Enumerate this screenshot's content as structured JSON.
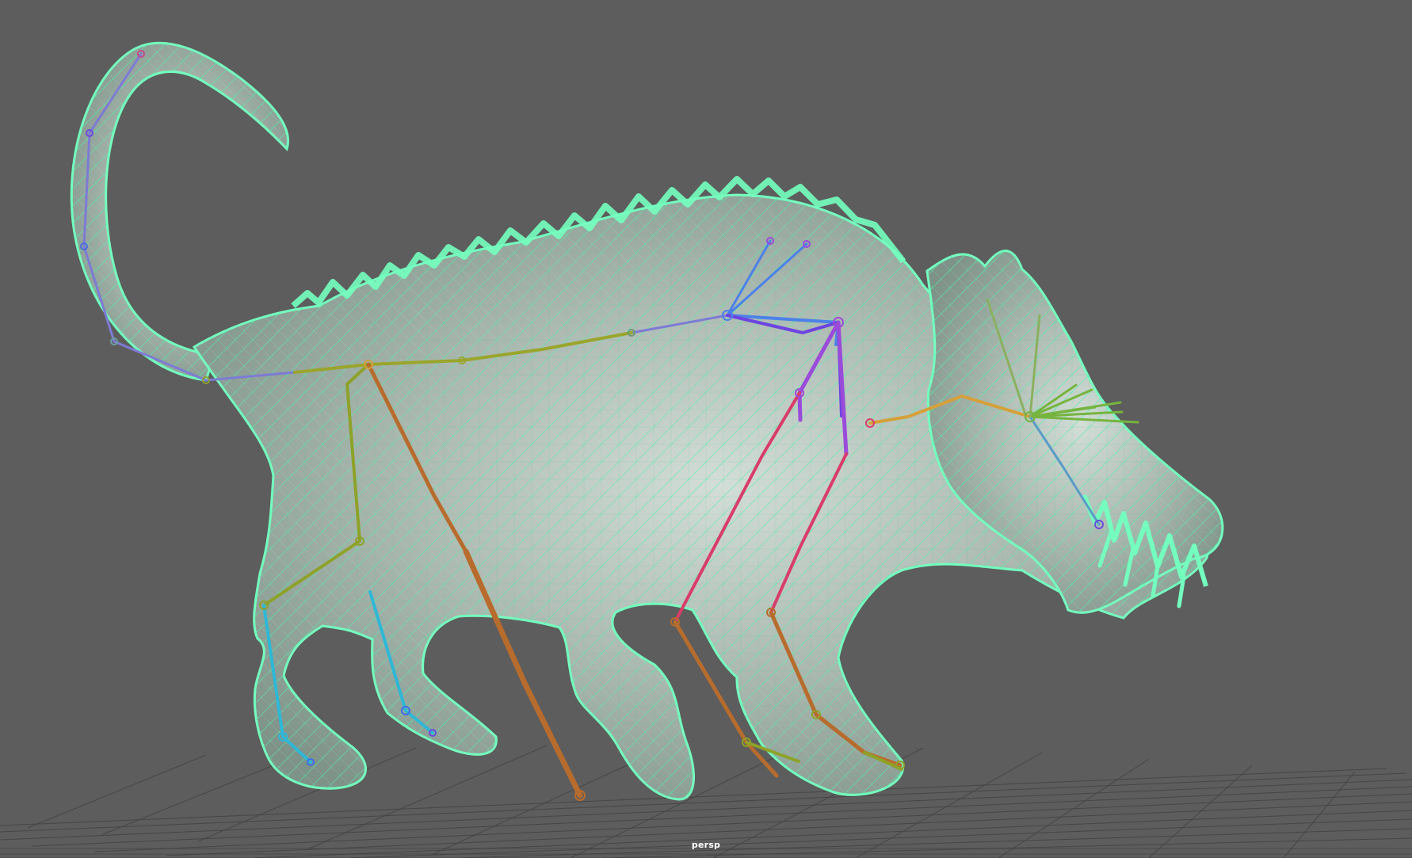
{
  "viewport": {
    "camera_label": "persp",
    "background_color": "#5d5d5d",
    "grid_color": "#454545",
    "wireframe_color": "#4dffa8",
    "surface_color": "#a8b5ad"
  },
  "skeleton": {
    "color_order": [
      "purple",
      "blue",
      "cyan",
      "green",
      "olive",
      "orange",
      "red",
      "magenta"
    ],
    "colors": {
      "purple": "#6a4bd8",
      "blue": "#3f6ee8",
      "cyan": "#2fb7d6",
      "green": "#5ea53a",
      "olive": "#8ea22a",
      "orange": "#b76c2d",
      "red": "#d83d6a",
      "magenta": "#9b4bd9"
    }
  }
}
